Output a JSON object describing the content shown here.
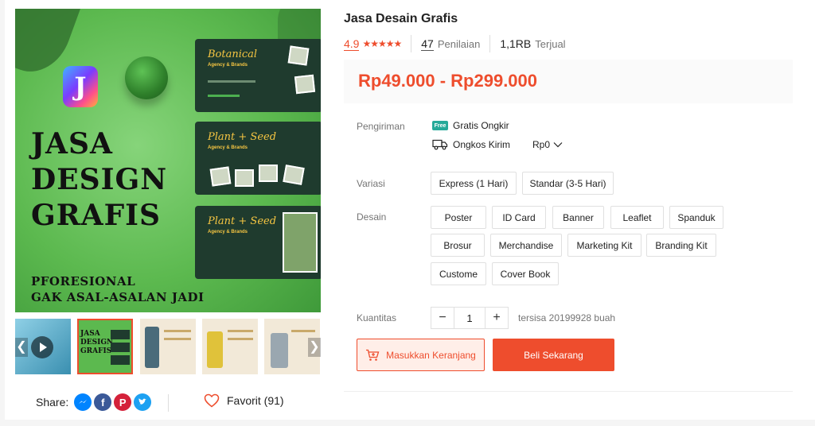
{
  "product": {
    "title": "Jasa Desain Grafis",
    "rating": "4.9",
    "stars": "★★★★★",
    "reviews_count": "47",
    "reviews_label": "Penilaian",
    "sold_count": "1,1RB",
    "sold_label": "Terjual",
    "price": "Rp49.000 - Rp299.000"
  },
  "gallery": {
    "main_image": {
      "logo_letter": "J",
      "headline": [
        "JASA",
        "DESIGN",
        "GRAFIS"
      ],
      "subline": [
        "PFORESIONAL",
        "GAK ASAL-ASALAN JADI"
      ],
      "slides": [
        {
          "title": "Botanical",
          "subtitle": "Agency & Brands"
        },
        {
          "title": "Plant + Seed",
          "subtitle": "Agency & Brands"
        },
        {
          "title": "Plant + Seed",
          "subtitle": "Agency & Brands"
        }
      ]
    },
    "thumb_active_text": [
      "JASA",
      "DESIGN",
      "GRAFIS"
    ],
    "arrow_left": "❮",
    "arrow_right": "❯"
  },
  "share": {
    "label": "Share:",
    "icons": [
      "messenger-icon",
      "facebook-icon",
      "pinterest-icon",
      "twitter-icon"
    ],
    "colors": {
      "messenger": "#0084ff",
      "facebook": "#3b5998",
      "pinterest": "#d4213a",
      "twitter": "#1da1f2"
    }
  },
  "favorite": {
    "label": "Favorit (91)"
  },
  "shipping": {
    "label": "Pengiriman",
    "free_badge": "Free",
    "free_label": "Gratis Ongkir",
    "cost_label": "Ongkos Kirim",
    "cost_value": "Rp0"
  },
  "variasi": {
    "label": "Variasi",
    "options": [
      "Express (1 Hari)",
      "Standar (3-5 Hari)"
    ]
  },
  "desain": {
    "label": "Desain",
    "options": [
      "Poster",
      "ID Card",
      "Banner",
      "Leaflet",
      "Spanduk",
      "Brosur",
      "Merchandise",
      "Marketing Kit",
      "Branding Kit",
      "Custome",
      "Cover Book"
    ]
  },
  "quantity": {
    "label": "Kuantitas",
    "minus": "−",
    "value": "1",
    "plus": "+",
    "stock": "tersisa 20199928 buah"
  },
  "actions": {
    "add_to_cart": "Masukkan Keranjang",
    "buy_now": "Beli Sekarang"
  },
  "colors": {
    "accent": "#ee4d2d",
    "accent_light": "#ffeee8",
    "free_shipping": "#26aa99"
  }
}
